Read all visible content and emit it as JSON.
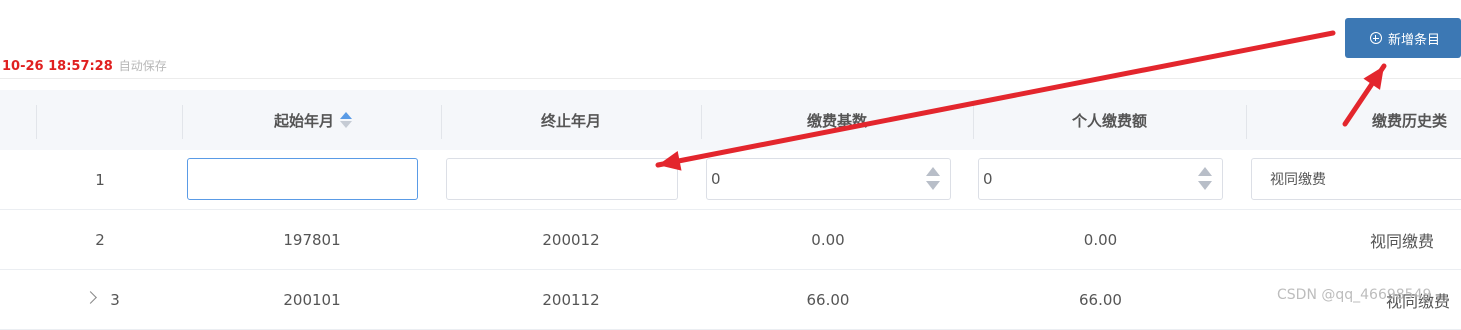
{
  "save_status": {
    "time": "10-26 18:57:28",
    "label": "自动保存"
  },
  "add_button": {
    "label": "新增条目"
  },
  "table": {
    "columns": [
      "起始年月",
      "终止年月",
      "缴费基数",
      "个人缴费额",
      "缴费历史类"
    ],
    "sort": {
      "column": "起始年月",
      "direction": "ascending"
    },
    "edit_row": {
      "index": "1",
      "start_month_value": "",
      "end_month_value": "",
      "base_value": "0",
      "personal_amount_value": "0",
      "history_type_value": "视同缴费"
    },
    "rows": [
      {
        "index": "2",
        "start": "197801",
        "end": "200012",
        "base": "0.00",
        "personal": "0.00",
        "type": "视同缴费"
      },
      {
        "index": "3",
        "start": "200101",
        "end": "200112",
        "base": "66.00",
        "personal": "66.00",
        "type": "视同缴费"
      }
    ]
  },
  "watermark": "CSDN @qq_46698549",
  "annotation_color": "#e3262d"
}
